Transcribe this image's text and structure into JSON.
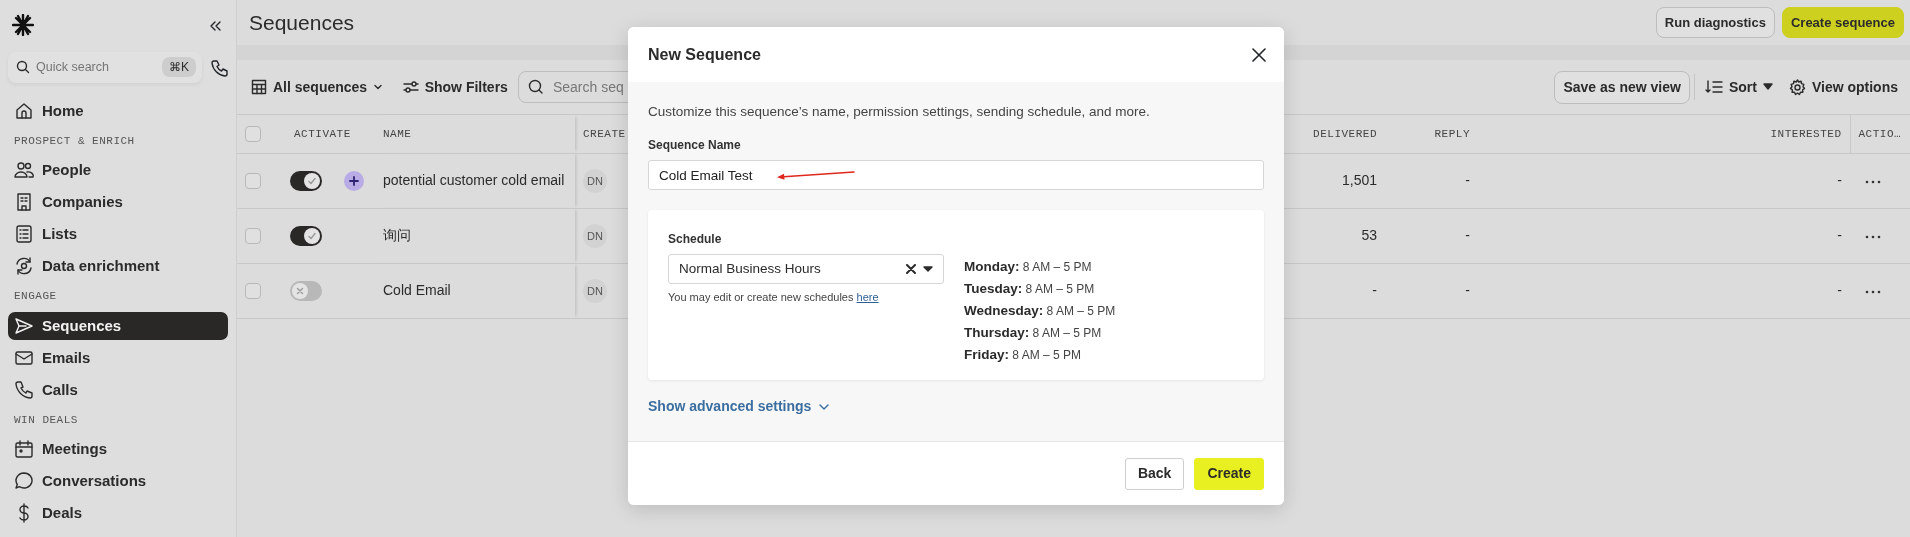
{
  "sidebar": {
    "search": {
      "placeholder": "Quick search",
      "shortcut": "⌘K"
    },
    "nav": [
      {
        "kind": "link",
        "label": "Home",
        "selected": false
      },
      {
        "kind": "heading",
        "label": "PROSPECT & ENRICH"
      },
      {
        "kind": "link",
        "label": "People",
        "selected": false
      },
      {
        "kind": "link",
        "label": "Companies",
        "selected": false
      },
      {
        "kind": "link",
        "label": "Lists",
        "selected": false
      },
      {
        "kind": "link",
        "label": "Data enrichment",
        "selected": false
      },
      {
        "kind": "heading",
        "label": "ENGAGE"
      },
      {
        "kind": "link",
        "label": "Sequences",
        "selected": true
      },
      {
        "kind": "link",
        "label": "Emails",
        "selected": false
      },
      {
        "kind": "link",
        "label": "Calls",
        "selected": false
      },
      {
        "kind": "heading",
        "label": "WIN DEALS"
      },
      {
        "kind": "link",
        "label": "Meetings",
        "selected": false
      },
      {
        "kind": "link",
        "label": "Conversations",
        "selected": false
      },
      {
        "kind": "link",
        "label": "Deals",
        "selected": false
      }
    ]
  },
  "header": {
    "title": "Sequences",
    "buttons": [
      {
        "label": "Run diagnostics",
        "kind": "secondary"
      },
      {
        "label": "Create sequence",
        "kind": "primary"
      }
    ]
  },
  "toolbar": {
    "view": "All sequences",
    "filters": "Show Filters",
    "search": {
      "placeholder": "Search seq"
    },
    "save_view": "Save as new view",
    "sort": "Sort",
    "view_options": "View options"
  },
  "table": {
    "select_all": false,
    "columns": {
      "activate": "ACTIVATE",
      "name": "NAME",
      "created": "CREATE",
      "delivered": "DELIVERED",
      "reply": "REPLY",
      "interested": "INTERESTED",
      "actions": "ACTIO…"
    },
    "rows": [
      {
        "selected": false,
        "on": true,
        "ai": true,
        "name": "potential customer cold email",
        "owner": "DN",
        "delivered": "1,501",
        "reply": "-",
        "interested": "-"
      },
      {
        "selected": false,
        "on": true,
        "ai": false,
        "name": "询问",
        "owner": "DN",
        "delivered": "53",
        "reply": "-",
        "interested": "-"
      },
      {
        "selected": false,
        "on": false,
        "ai": false,
        "name": "Cold Email",
        "owner": "DN",
        "delivered": "-",
        "reply": "-",
        "interested": "-"
      }
    ]
  },
  "modal": {
    "title": "New Sequence",
    "description": "Customize this sequence’s name, permission settings, sending schedule, and more.",
    "name_label": "Sequence Name",
    "name_value": "Cold Email Test",
    "schedule": {
      "label": "Schedule",
      "value": "Normal Business Hours",
      "help": "You may edit or create new schedules",
      "help_link": "here",
      "hours": [
        {
          "day": "Monday:",
          "time": "8 AM – 5 PM"
        },
        {
          "day": "Tuesday:",
          "time": "8 AM – 5 PM"
        },
        {
          "day": "Wednesday:",
          "time": "8 AM – 5 PM"
        },
        {
          "day": "Thursday:",
          "time": "8 AM – 5 PM"
        },
        {
          "day": "Friday:",
          "time": "8 AM – 5 PM"
        }
      ]
    },
    "advanced": "Show advanced settings",
    "buttons": [
      {
        "label": "Back",
        "kind": "secondary"
      },
      {
        "label": "Create",
        "kind": "primary"
      }
    ]
  }
}
